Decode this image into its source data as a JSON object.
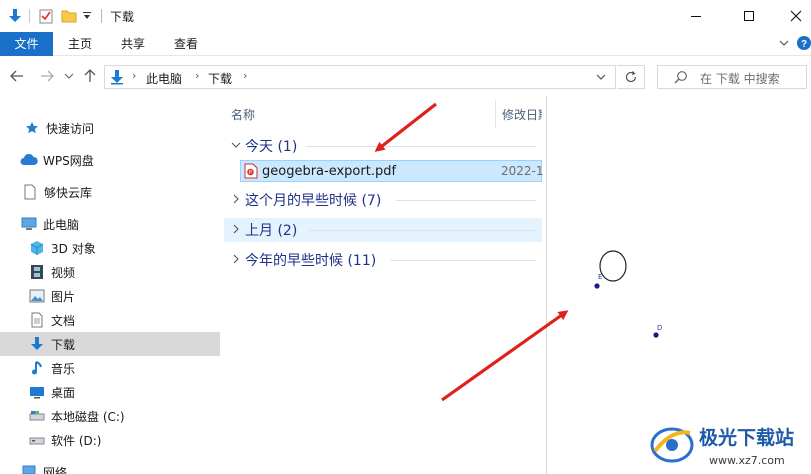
{
  "window": {
    "title": "下载",
    "controls": [
      "minimize",
      "maximize",
      "close"
    ]
  },
  "ribbon": {
    "tabs": [
      "文件",
      "主页",
      "共享",
      "查看"
    ],
    "active_tab": "文件"
  },
  "address": {
    "breadcrumb": [
      "此电脑",
      "下载"
    ],
    "search_placeholder": "在 下载 中搜索"
  },
  "sidebar": {
    "items": [
      {
        "label": "快速访问",
        "icon": "star-icon"
      },
      {
        "label": "WPS网盘",
        "icon": "cloud-icon"
      },
      {
        "label": "够快云库",
        "icon": "document-icon"
      },
      {
        "label": "此电脑",
        "icon": "computer-icon"
      },
      {
        "label": "3D 对象",
        "icon": "cube-icon"
      },
      {
        "label": "视频",
        "icon": "film-icon"
      },
      {
        "label": "图片",
        "icon": "picture-icon"
      },
      {
        "label": "文档",
        "icon": "document-icon"
      },
      {
        "label": "下载",
        "icon": "download-arrow-icon",
        "selected": true
      },
      {
        "label": "音乐",
        "icon": "music-note-icon"
      },
      {
        "label": "桌面",
        "icon": "desktop-icon"
      },
      {
        "label": "本地磁盘 (C:)",
        "icon": "drive-icon"
      },
      {
        "label": "软件 (D:)",
        "icon": "drive-icon"
      },
      {
        "label": "网络",
        "icon": "network-icon"
      }
    ]
  },
  "filelist": {
    "columns": [
      "名称",
      "修改日期"
    ],
    "groups": [
      {
        "title": "今天 (1)",
        "expanded": true
      },
      {
        "title": "这个月的早些时候 (7)",
        "expanded": false
      },
      {
        "title": "上月 (2)",
        "expanded": false,
        "highlighted": true
      },
      {
        "title": "今年的早些时候 (11)",
        "expanded": false
      }
    ],
    "files": [
      {
        "name": "geogebra-export.pdf",
        "date": "2022-1",
        "icon": "pdf-file-icon",
        "selected": true
      }
    ]
  },
  "preview": {
    "points": [
      {
        "label": "E"
      },
      {
        "label": "D"
      }
    ]
  },
  "watermark": {
    "name": "极光下载站",
    "url": "www.xz7.com"
  },
  "colors": {
    "accent": "#1a6fc8",
    "selection": "#cce8ff",
    "group_text": "#1e3287",
    "arrow": "#e0201b"
  }
}
